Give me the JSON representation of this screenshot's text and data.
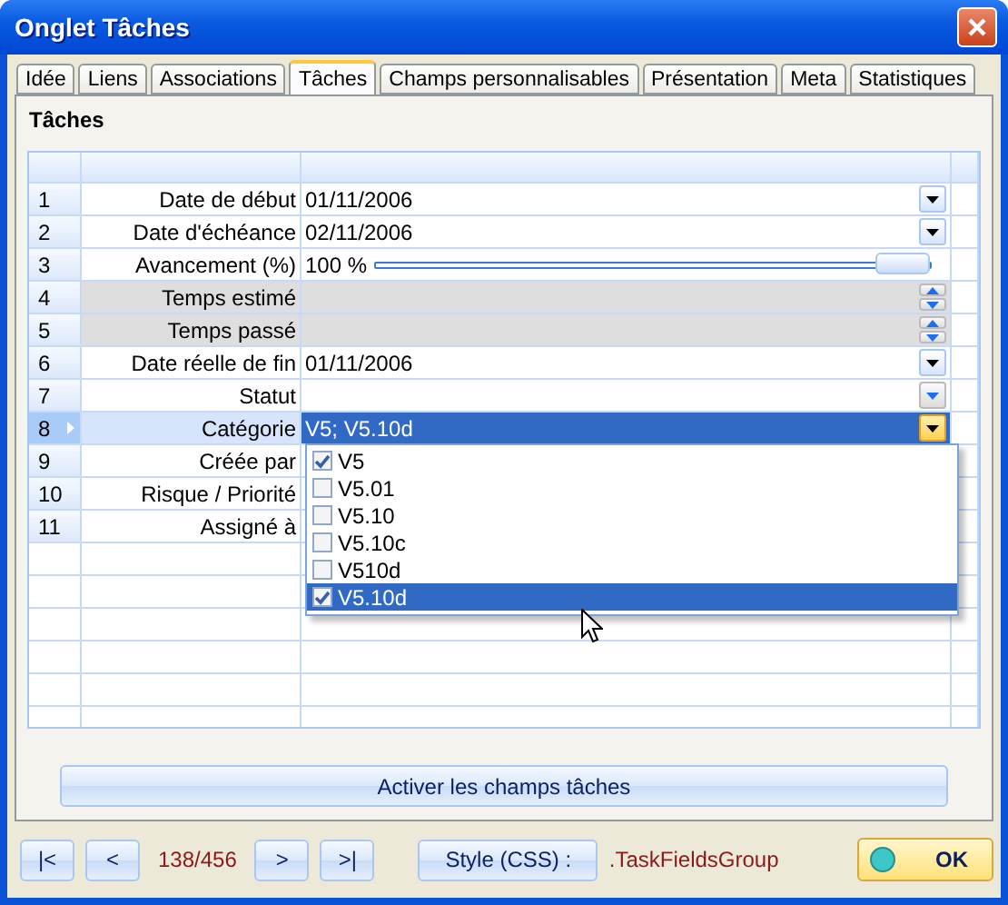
{
  "window": {
    "title": "Onglet Tâches"
  },
  "tabs": [
    {
      "label": "Idée",
      "selected": false
    },
    {
      "label": "Liens",
      "selected": false
    },
    {
      "label": "Associations",
      "selected": false
    },
    {
      "label": "Tâches",
      "selected": true
    },
    {
      "label": "Champs personnalisables",
      "selected": false
    },
    {
      "label": "Présentation",
      "selected": false
    },
    {
      "label": "Meta",
      "selected": false
    },
    {
      "label": "Statistiques",
      "selected": false
    }
  ],
  "section_title": "Tâches",
  "grid": {
    "rows": [
      {
        "number": "1",
        "label": "Date de début",
        "value": "01/11/2006",
        "kind": "date",
        "shaded": false,
        "selected": false
      },
      {
        "number": "2",
        "label": "Date d'échéance",
        "value": "02/11/2006",
        "kind": "date",
        "shaded": false,
        "selected": false
      },
      {
        "number": "3",
        "label": "Avancement (%)",
        "value": "100 %",
        "kind": "slider",
        "level": 1,
        "shaded": false,
        "selected": false
      },
      {
        "number": "4",
        "label": "Temps estimé",
        "kind": "spin",
        "shaded": true,
        "selected": false
      },
      {
        "number": "5",
        "label": "Temps passé",
        "kind": "spin",
        "shaded": true,
        "selected": false
      },
      {
        "number": "6",
        "label": "Date réelle de fin",
        "value": "01/11/2006",
        "kind": "date",
        "shaded": false,
        "selected": false
      },
      {
        "number": "7",
        "label": "Statut",
        "kind": "list",
        "shaded": false,
        "selected": false
      },
      {
        "number": "8",
        "label": "Catégorie",
        "value": "V5; V5.10d",
        "kind": "list",
        "shaded": false,
        "selected": true
      },
      {
        "number": "9",
        "label": "Créée par",
        "kind": "text",
        "shaded": false,
        "selected": false
      },
      {
        "number": "10",
        "label": "Risque / Priorité",
        "kind": "text",
        "shaded": false,
        "selected": false
      },
      {
        "number": "11",
        "label": "Assigné à",
        "kind": "text",
        "shaded": false,
        "selected": false
      }
    ]
  },
  "dropdown": {
    "options": [
      {
        "label": "V5",
        "checked": true,
        "selected": false
      },
      {
        "label": "V5.01",
        "checked": false,
        "selected": false
      },
      {
        "label": "V5.10",
        "checked": false,
        "selected": false
      },
      {
        "label": "V5.10c",
        "checked": false,
        "selected": false
      },
      {
        "label": "V510d",
        "checked": false,
        "selected": false
      },
      {
        "label": "V5.10d",
        "checked": true,
        "selected": true
      }
    ]
  },
  "activate_button": "Activer les champs tâches",
  "footer": {
    "first": "|<",
    "previous": "<",
    "counter": "138/456",
    "next": ">",
    "last": ">|",
    "style_button": "Style (CSS) :",
    "style_value": ".TaskFieldsGroup",
    "ok": "OK"
  }
}
